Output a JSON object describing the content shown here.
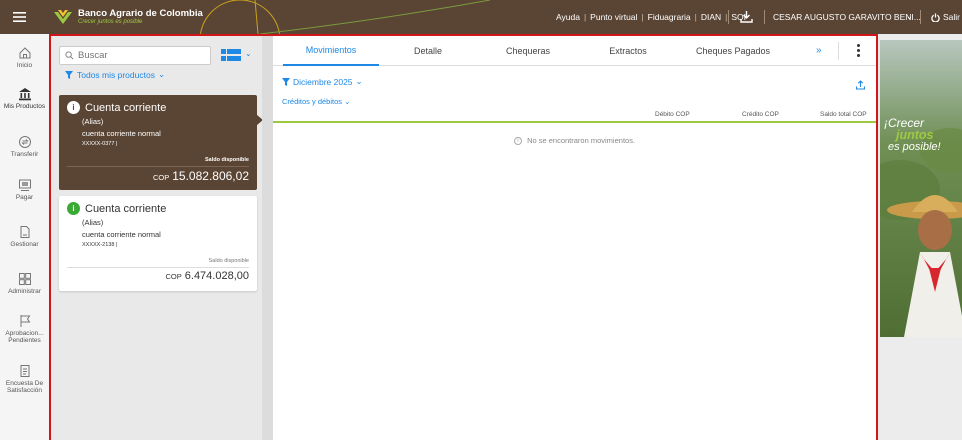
{
  "colors": {
    "brand_brown": "#5a4535",
    "brand_green": "#9dc940",
    "accent_blue": "#1e88e5",
    "highlight_red": "#d0161a"
  },
  "header": {
    "menu_icon": "hamburger-icon",
    "brand_name": "Banco Agrario de Colombia",
    "brand_tagline": "Crecer juntos es posible",
    "links": [
      "Ayuda",
      "Punto virtual",
      "Fiduagraria",
      "DIAN",
      "SOI"
    ],
    "user_name": "CESAR AUGUSTO GARAVITO BENI...",
    "logout_label": "Salir"
  },
  "sidebar": {
    "items": [
      {
        "label": "Inicio",
        "icon": "home-icon"
      },
      {
        "label": "Mis Productos",
        "icon": "bank-icon"
      },
      {
        "label": "Transferir",
        "icon": "transfer-icon"
      },
      {
        "label": "Pagar",
        "icon": "pay-icon"
      },
      {
        "label": "Gestionar",
        "icon": "manage-icon"
      },
      {
        "label": "Administrar",
        "icon": "grid-icon"
      },
      {
        "label": "Aprobacion... Pendientes",
        "icon": "flag-icon"
      },
      {
        "label": "Encuesta De Satisfacción",
        "icon": "survey-icon"
      }
    ]
  },
  "products": {
    "search_placeholder": "Buscar",
    "filter_label": "Todos mis productos",
    "cards": [
      {
        "title": "Cuenta corriente",
        "alias": "(Alias)",
        "type": "cuenta corriente normal",
        "number": "XXXXX-0377 |",
        "balance_label": "Saldo disponible",
        "currency": "COP",
        "amount": "15.082.806,02"
      },
      {
        "title": "Cuenta corriente",
        "alias": "(Alias)",
        "type": "cuenta corriente normal",
        "number": "XXXXX-2138 |",
        "balance_label": "Saldo disponible",
        "currency": "COP",
        "amount": "6.474.028,00"
      }
    ]
  },
  "detail": {
    "tabs": [
      "Movimientos",
      "Detalle",
      "Chequeras",
      "Extractos",
      "Cheques Pagados"
    ],
    "active_tab": "Movimientos",
    "month_filter": "Diciembre 2025",
    "type_filter": "Créditos y débitos",
    "columns": [
      "Débito COP",
      "Crédito COP",
      "Saldo total COP"
    ],
    "empty_message": "No se encontraron movimientos."
  },
  "banner": {
    "line1": "¡Crecer",
    "line2": "juntos",
    "line3": "es posible!"
  }
}
